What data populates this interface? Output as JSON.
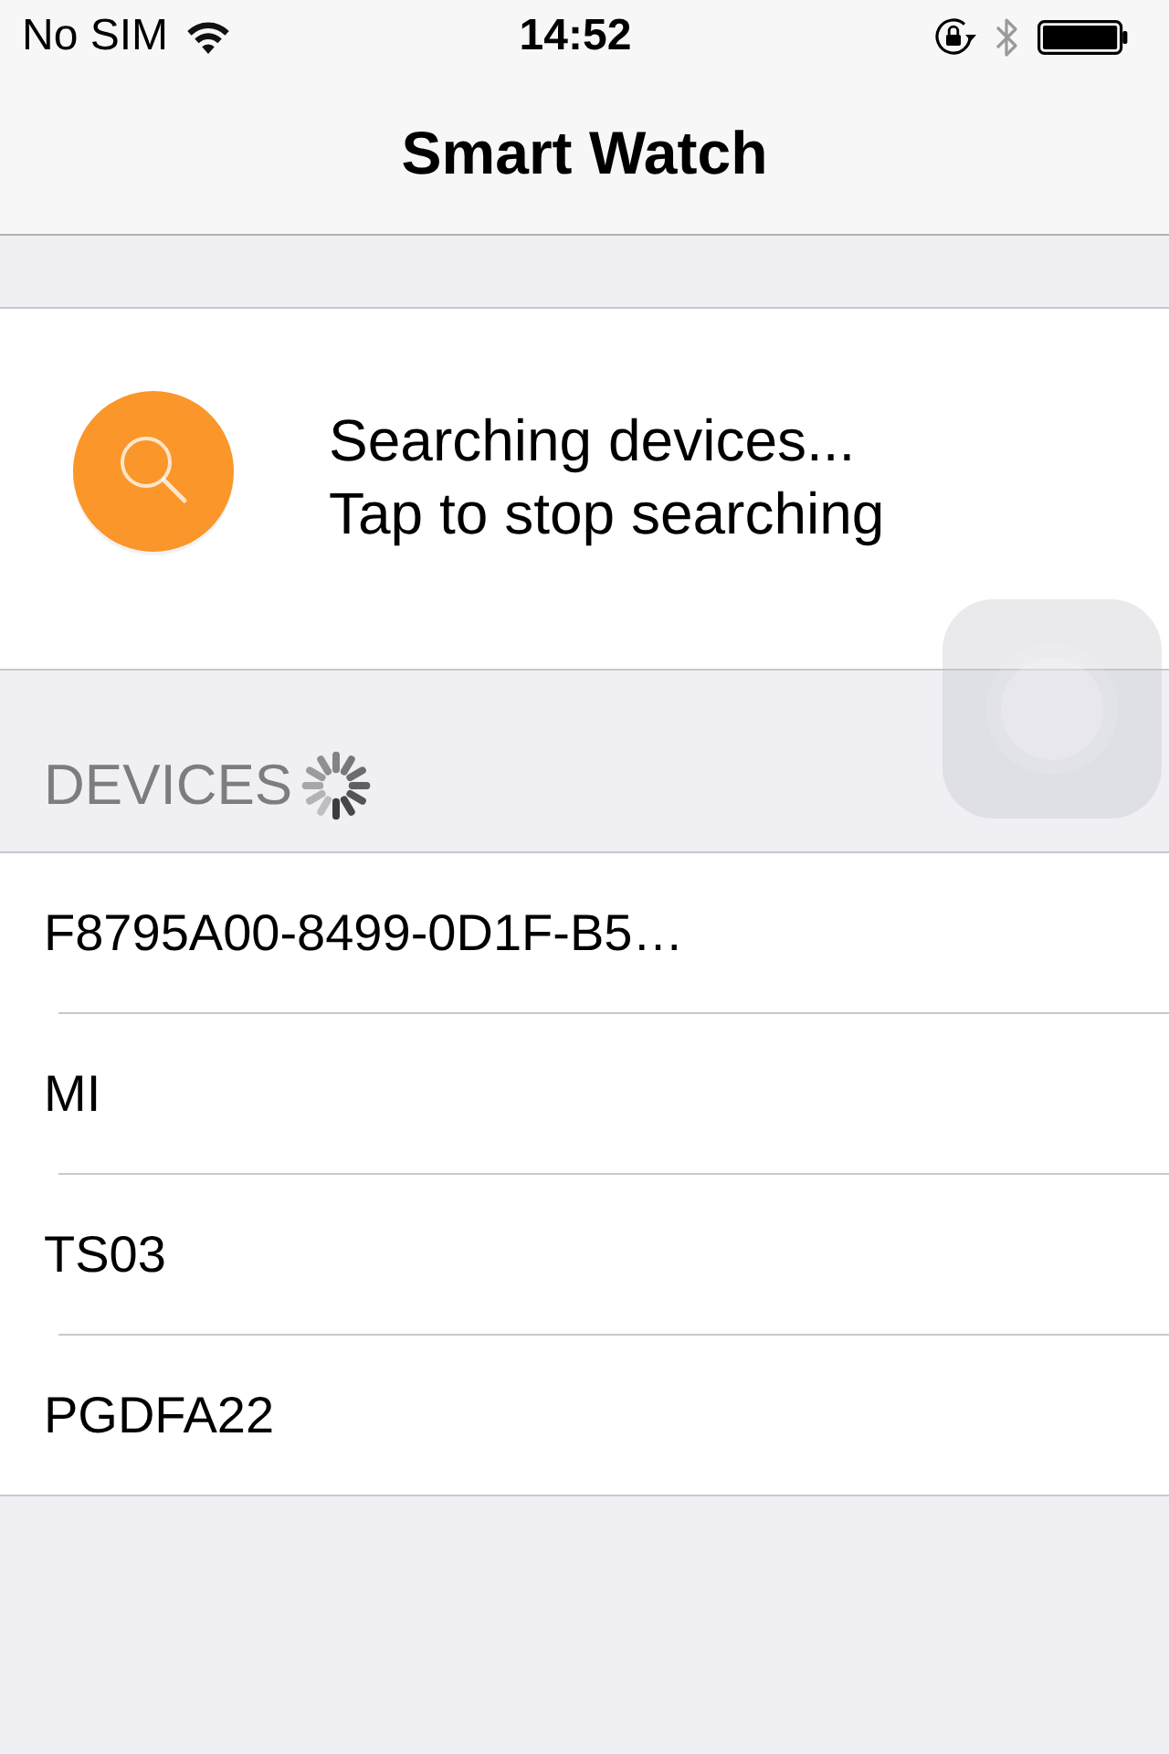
{
  "status_bar": {
    "carrier": "No SIM",
    "time": "14:52"
  },
  "nav_bar": {
    "title": "Smart Watch"
  },
  "search_panel": {
    "lines": [
      "Searching devices...",
      "Tap to stop searching"
    ]
  },
  "devices": {
    "header": "DEVICES",
    "loading": true,
    "items": [
      {
        "name": "F8795A00-8499-0D1F-B5…"
      },
      {
        "name": "MI"
      },
      {
        "name": "TS03"
      },
      {
        "name": "PGDFA22"
      }
    ]
  }
}
